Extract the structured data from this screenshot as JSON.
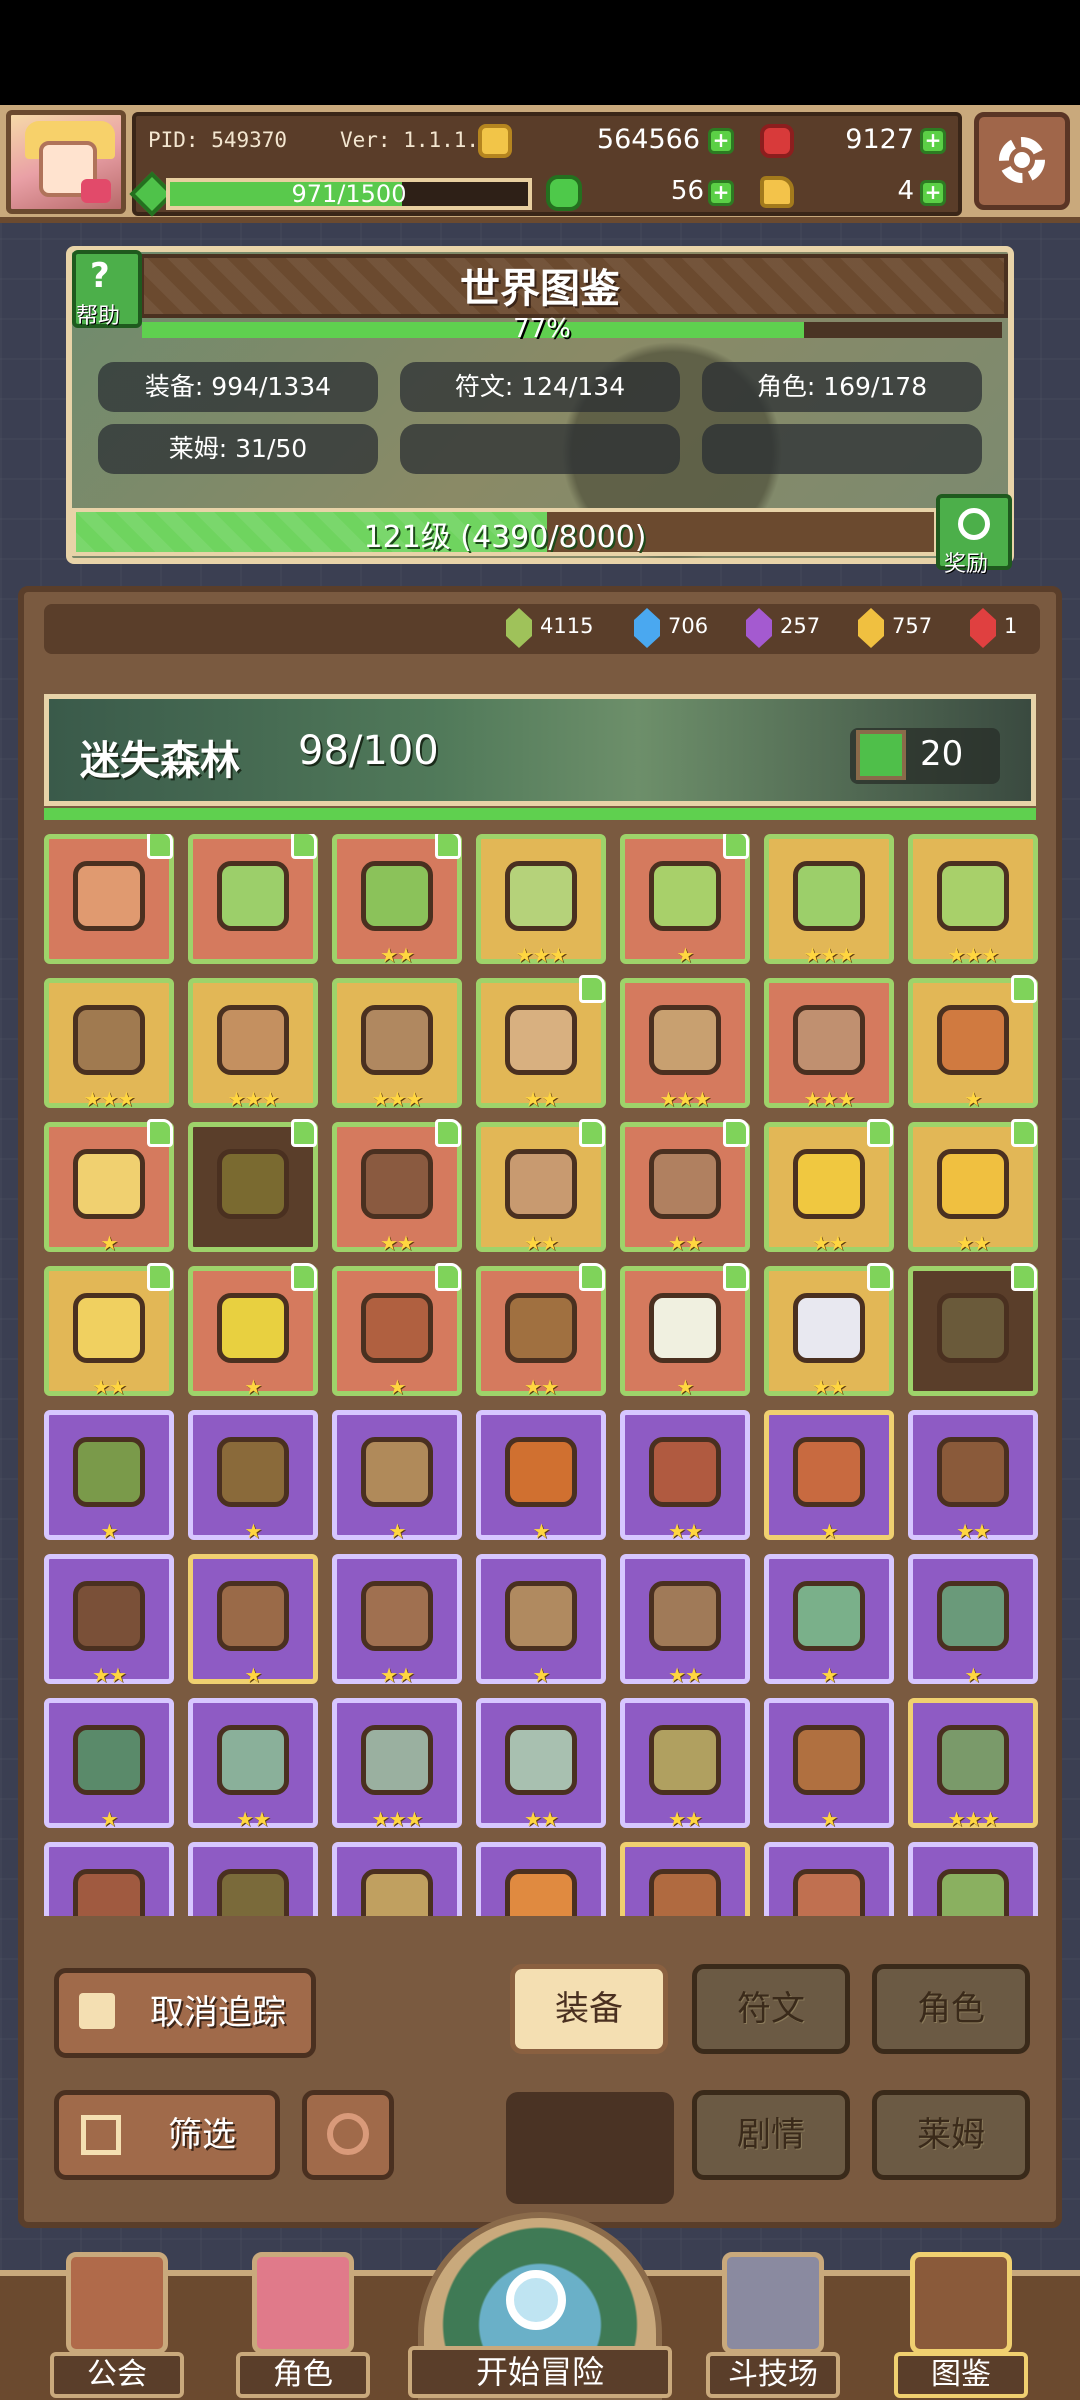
{
  "header": {
    "pid": "PID: 549370",
    "version": "Ver: 1.1.1.7",
    "coins": "564566",
    "gems": "9127",
    "stamina": "971/1500",
    "stamina_fraction": 0.647,
    "clovers": "56",
    "hands": "4"
  },
  "encyclopedia": {
    "title": "世界图鉴",
    "help_label": "帮助",
    "percent_text": "77%",
    "percent": 0.77,
    "stats": {
      "equipment": "装备: 994/1334",
      "runes": "符文: 124/134",
      "characters": "角色: 169/178",
      "slimes": "莱姆: 31/50"
    },
    "level_text": "121级 (4390/8000)",
    "level_fraction": 0.549,
    "reward_label": "奖励"
  },
  "crystals": [
    {
      "color": "#9fc25a",
      "value": "4115"
    },
    {
      "color": "#4aa8f0",
      "value": "706"
    },
    {
      "color": "#a45ad0",
      "value": "257"
    },
    {
      "color": "#f0c040",
      "value": "757"
    },
    {
      "color": "#e04040",
      "value": "1"
    }
  ],
  "area": {
    "name": "迷失森林",
    "count": "98/100",
    "likes": "20"
  },
  "items": [
    {
      "bg": "c-red",
      "art": "#e09a70",
      "stars": "",
      "tracked": true
    },
    {
      "bg": "c-red",
      "art": "#9ccf6a",
      "stars": "",
      "tracked": true
    },
    {
      "bg": "c-red",
      "art": "#8bc25a",
      "stars": "★★",
      "tracked": true
    },
    {
      "bg": "c-gold",
      "art": "#b5d27a",
      "stars": "★★★",
      "tracked": false
    },
    {
      "bg": "c-red",
      "art": "#a8d06a",
      "stars": "★",
      "tracked": true
    },
    {
      "bg": "c-gold",
      "art": "#9ccf6a",
      "stars": "★★★",
      "tracked": false
    },
    {
      "bg": "c-gold",
      "art": "#a8d06a",
      "stars": "★★★",
      "tracked": false
    },
    {
      "bg": "c-gold",
      "art": "#a07a50",
      "stars": "★★★",
      "tracked": false
    },
    {
      "bg": "c-gold",
      "art": "#c49060",
      "stars": "★★★",
      "tracked": false
    },
    {
      "bg": "c-gold",
      "art": "#b08860",
      "stars": "★★★",
      "tracked": false
    },
    {
      "bg": "c-gold",
      "art": "#d8b080",
      "stars": "★★",
      "tracked": true
    },
    {
      "bg": "c-red",
      "art": "#c8a070",
      "stars": "★★★",
      "tracked": false
    },
    {
      "bg": "c-red",
      "art": "#c09070",
      "stars": "★★★",
      "tracked": false
    },
    {
      "bg": "c-gold",
      "art": "#d07a40",
      "stars": "★",
      "tracked": true
    },
    {
      "bg": "c-red",
      "art": "#f0d070",
      "stars": "★",
      "tracked": true
    },
    {
      "bg": "c-dark",
      "art": "#7a6a30",
      "stars": "",
      "tracked": true
    },
    {
      "bg": "c-red",
      "art": "#8a5a40",
      "stars": "★★",
      "tracked": true
    },
    {
      "bg": "c-gold",
      "art": "#c89a70",
      "stars": "★★",
      "tracked": true
    },
    {
      "bg": "c-red",
      "art": "#b08060",
      "stars": "★★",
      "tracked": true
    },
    {
      "bg": "c-gold",
      "art": "#f0c840",
      "stars": "★★",
      "tracked": true
    },
    {
      "bg": "c-gold",
      "art": "#f0c040",
      "stars": "★★",
      "tracked": true
    },
    {
      "bg": "c-gold",
      "art": "#f0d060",
      "stars": "★★",
      "tracked": true
    },
    {
      "bg": "c-red",
      "art": "#e8d040",
      "stars": "★",
      "tracked": true
    },
    {
      "bg": "c-red",
      "art": "#b06040",
      "stars": "★",
      "tracked": true
    },
    {
      "bg": "c-red",
      "art": "#a07040",
      "stars": "★★",
      "tracked": true
    },
    {
      "bg": "c-red",
      "art": "#f0f0e0",
      "stars": "★",
      "tracked": true
    },
    {
      "bg": "c-gold",
      "art": "#e8e8f0",
      "stars": "★★",
      "tracked": true
    },
    {
      "bg": "c-dark",
      "art": "#6a5a3a",
      "stars": "",
      "tracked": true
    },
    {
      "bg": "c-purple",
      "art": "#7a9a4a",
      "stars": "★",
      "tracked": false
    },
    {
      "bg": "c-purple",
      "art": "#8a6a3a",
      "stars": "★",
      "tracked": false
    },
    {
      "bg": "c-purple",
      "art": "#b08a5a",
      "stars": "★",
      "tracked": false
    },
    {
      "bg": "c-purple",
      "art": "#d07030",
      "stars": "★",
      "tracked": false
    },
    {
      "bg": "c-purple",
      "art": "#b05a40",
      "stars": "★★",
      "tracked": false
    },
    {
      "bg": "c-purple-gold",
      "art": "#c86a40",
      "stars": "★",
      "tracked": false
    },
    {
      "bg": "c-purple",
      "art": "#8a5a3a",
      "stars": "★★",
      "tracked": false
    },
    {
      "bg": "c-purple",
      "art": "#7a5038",
      "stars": "★★",
      "tracked": false
    },
    {
      "bg": "c-purple-gold",
      "art": "#9a6a48",
      "stars": "★",
      "tracked": false
    },
    {
      "bg": "c-purple",
      "art": "#a07050",
      "stars": "★★",
      "tracked": false
    },
    {
      "bg": "c-purple",
      "art": "#b08a60",
      "stars": "★",
      "tracked": false
    },
    {
      "bg": "c-purple",
      "art": "#a07a58",
      "stars": "★★",
      "tracked": false
    },
    {
      "bg": "c-purple",
      "art": "#7ab08a",
      "stars": "★",
      "tracked": false
    },
    {
      "bg": "c-purple",
      "art": "#6a9a7a",
      "stars": "★",
      "tracked": false
    },
    {
      "bg": "c-purple",
      "art": "#5a8a6a",
      "stars": "★",
      "tracked": false
    },
    {
      "bg": "c-purple",
      "art": "#8ab09a",
      "stars": "★★",
      "tracked": false
    },
    {
      "bg": "c-purple",
      "art": "#9ab0a0",
      "stars": "★★★",
      "tracked": false
    },
    {
      "bg": "c-purple",
      "art": "#a8c0b0",
      "stars": "★★",
      "tracked": false
    },
    {
      "bg": "c-purple",
      "art": "#b0a060",
      "stars": "★★",
      "tracked": false
    },
    {
      "bg": "c-purple",
      "art": "#b07040",
      "stars": "★",
      "tracked": false
    },
    {
      "bg": "c-purple-gold",
      "art": "#7a9a6a",
      "stars": "★★★",
      "tracked": false
    },
    {
      "bg": "c-purple",
      "art": "#a05a40",
      "stars": "",
      "tracked": false
    },
    {
      "bg": "c-purple",
      "art": "#7a6a3a",
      "stars": "",
      "tracked": false
    },
    {
      "bg": "c-purple",
      "art": "#c0a060",
      "stars": "",
      "tracked": false
    },
    {
      "bg": "c-purple",
      "art": "#e08a40",
      "stars": "",
      "tracked": false
    },
    {
      "bg": "c-purple-gold",
      "art": "#b06a40",
      "stars": "",
      "tracked": false
    },
    {
      "bg": "c-purple",
      "art": "#c07050",
      "stars": "",
      "tracked": false
    },
    {
      "bg": "c-purple",
      "art": "#8ab060",
      "stars": "",
      "tracked": false
    }
  ],
  "controls": {
    "untrack": "取消追踪",
    "filter": "筛选",
    "tab_equipment": "装备",
    "tab_runes": "符文",
    "tab_characters": "角色",
    "tab_story": "剧情",
    "tab_slimes": "莱姆"
  },
  "nav": {
    "guild": "公会",
    "character": "角色",
    "adventure": "开始冒险",
    "arena": "斗技场",
    "encyclopedia": "图鉴"
  }
}
